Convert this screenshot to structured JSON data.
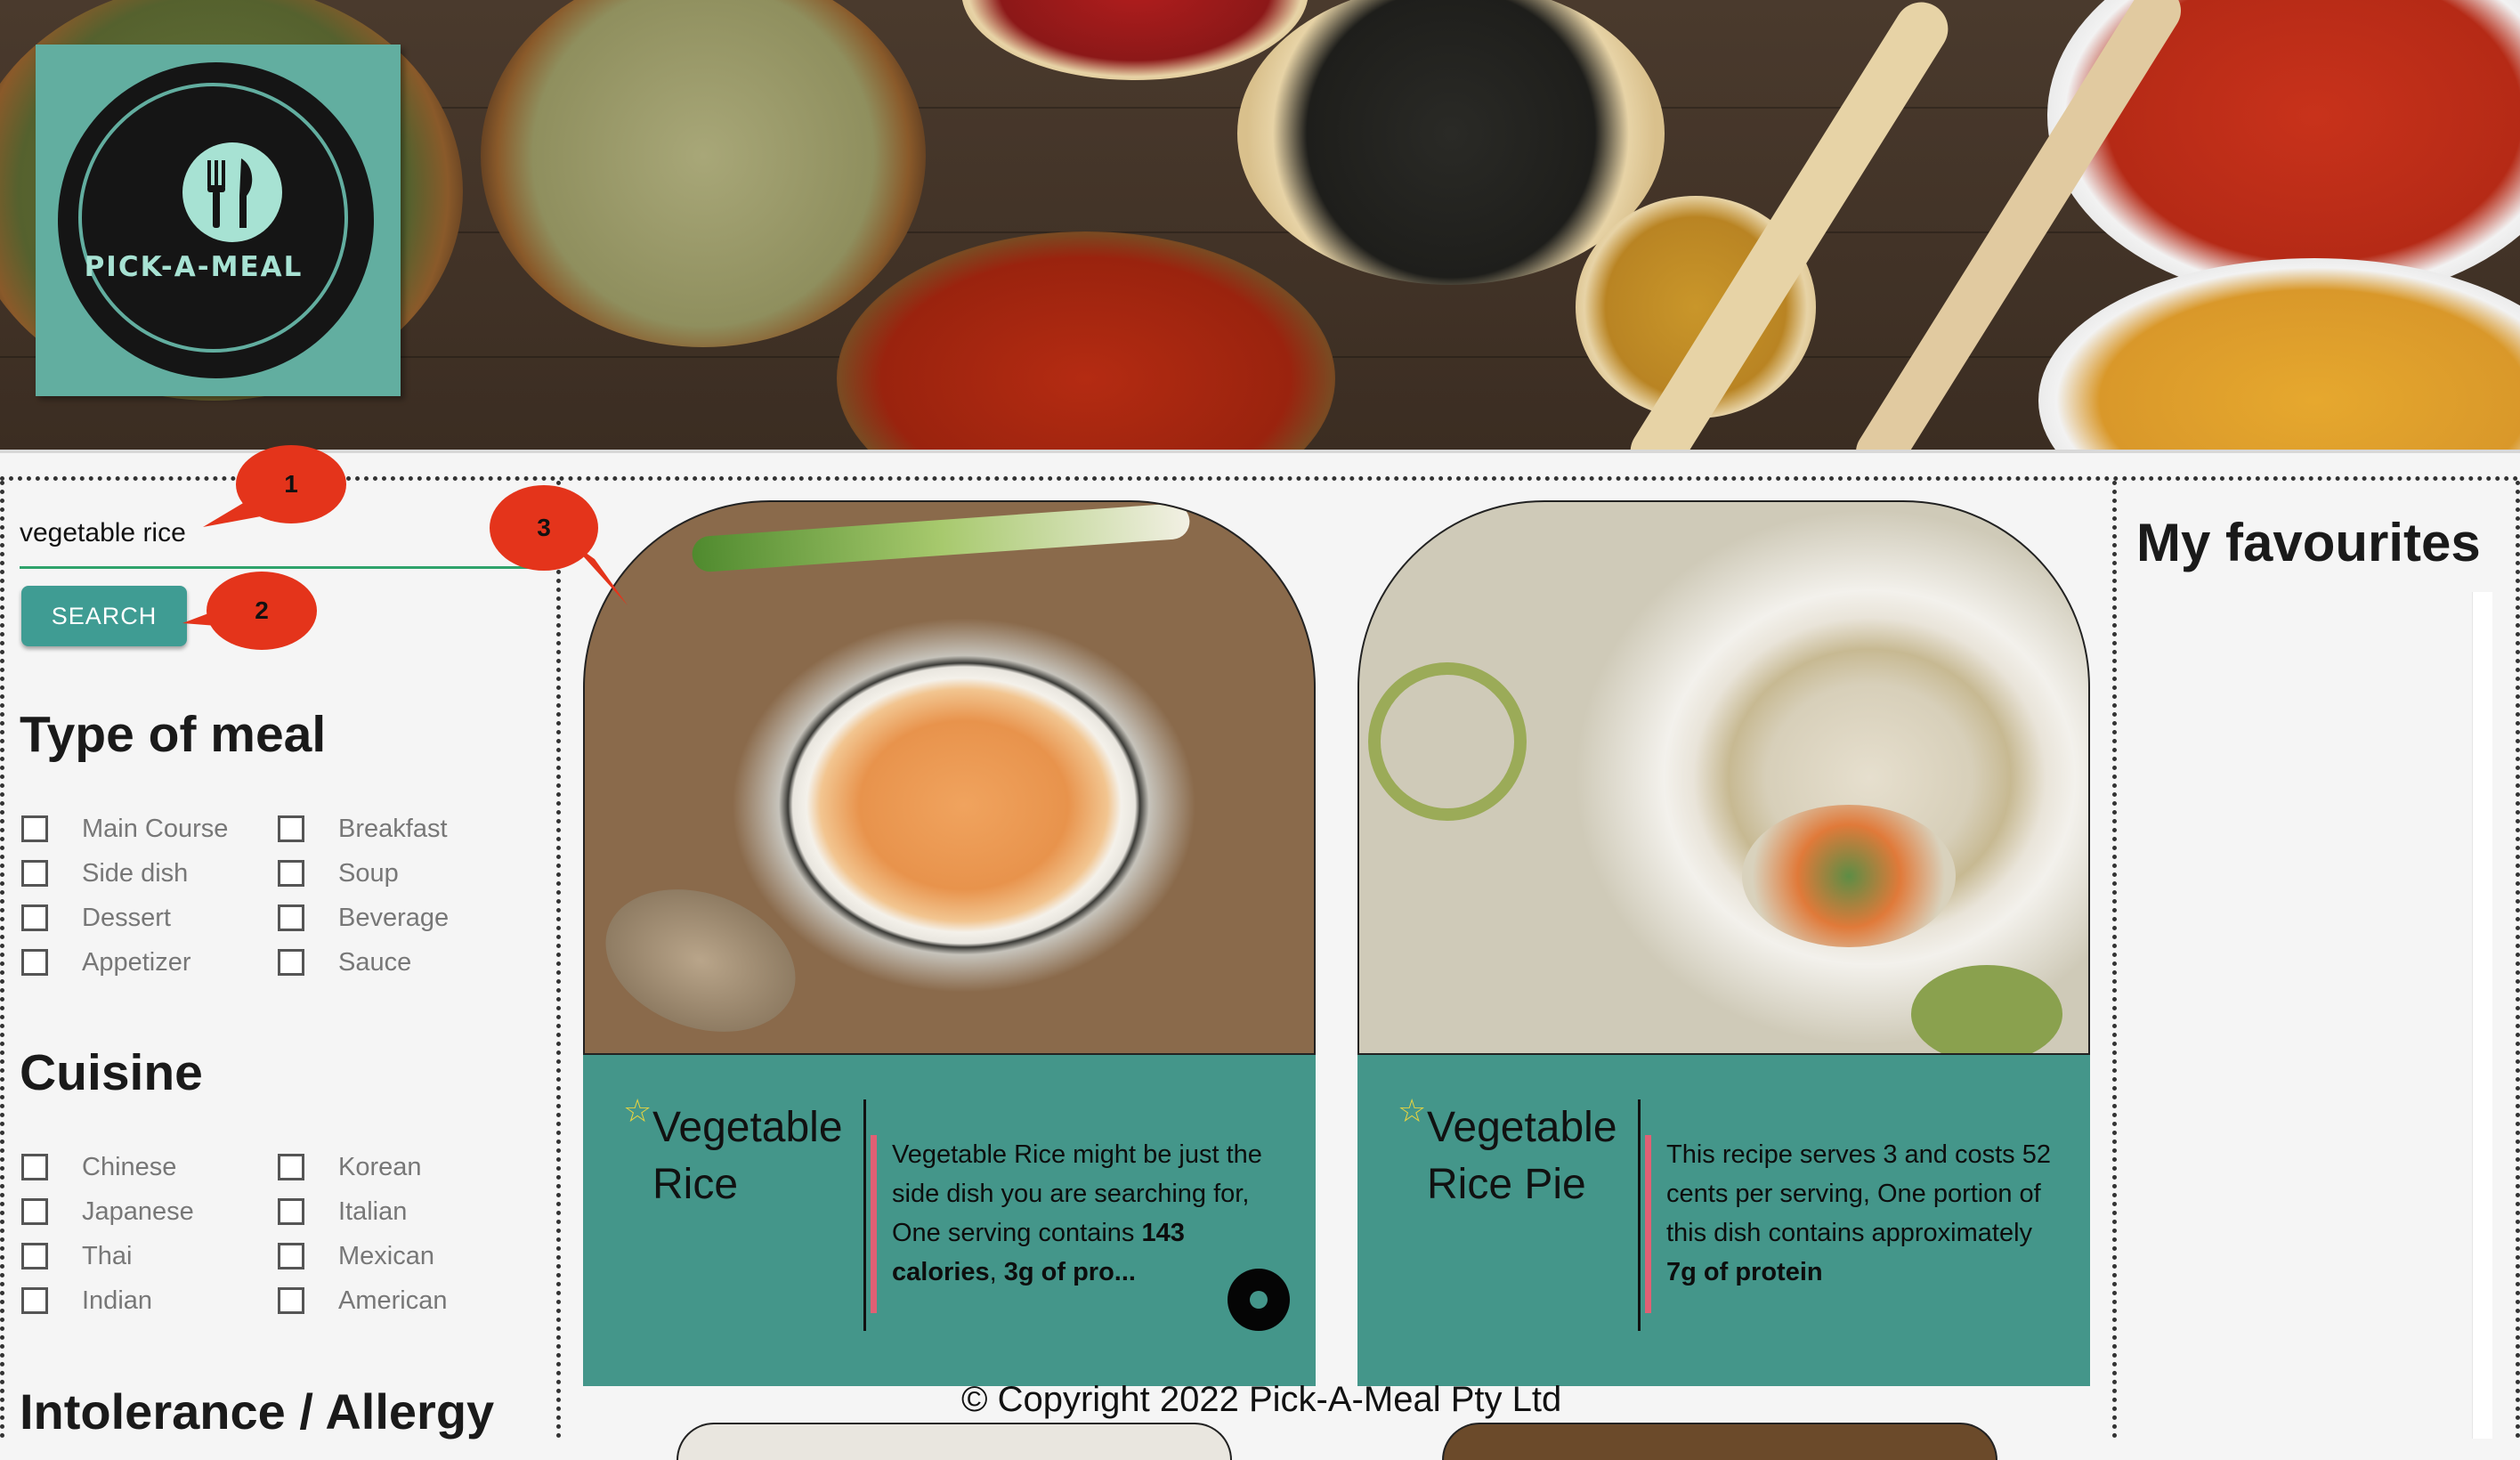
{
  "brand": {
    "logo_text": "PICK-A-MEAL"
  },
  "search": {
    "value": "vegetable rice",
    "button_label": "SEARCH"
  },
  "filters": {
    "type_of_meal": {
      "title": "Type of meal",
      "options": [
        "Main Course",
        "Breakfast",
        "Side dish",
        "Soup",
        "Dessert",
        "Beverage",
        "Appetizer",
        "Sauce"
      ]
    },
    "cuisine": {
      "title": "Cuisine",
      "options": [
        "Chinese",
        "Korean",
        "Japanese",
        "Italian",
        "Thai",
        "Mexican",
        "Indian",
        "American"
      ]
    },
    "intolerance": {
      "title": "Intolerance / Allergy"
    }
  },
  "results": [
    {
      "title": "Vegetable Rice",
      "desc_pre": "Vegetable Rice might be just the side dish you are searching for, One serving contains ",
      "desc_b1": "143 calories",
      "desc_mid": ", ",
      "desc_b2": "3g of pro...",
      "icon": "star-outline"
    },
    {
      "title": "Vegetable Rice Pie",
      "desc_pre": "This recipe serves 3 and costs 52 cents per serving, One portion of this dish contains approximately ",
      "desc_b1": "7g of protein",
      "icon": "star-outline"
    }
  ],
  "favourites": {
    "title": "My favourites"
  },
  "footer": {
    "copyright": "© Copyright 2022 Pick-A-Meal Pty Ltd"
  },
  "annotations": [
    "1",
    "2",
    "3"
  ],
  "colors": {
    "teal": "#44968a",
    "button": "#3f9c93",
    "accent": "#e06074",
    "annotation": "#e4341b"
  }
}
